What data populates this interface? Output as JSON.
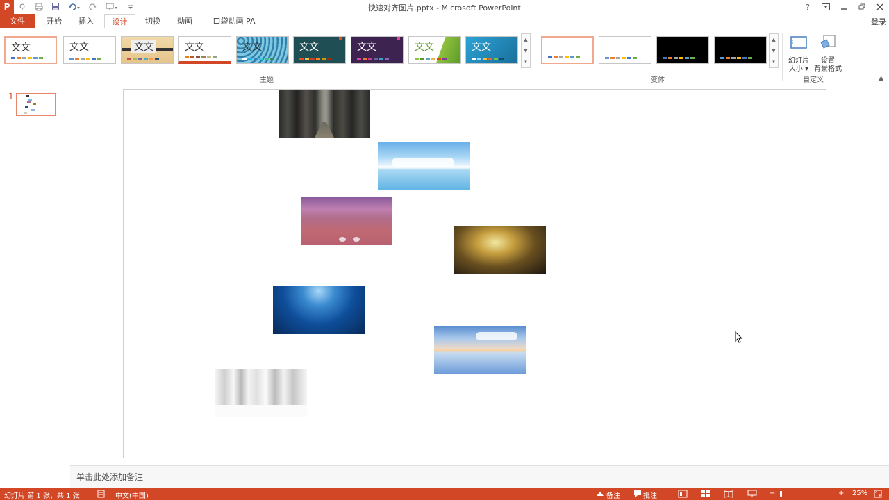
{
  "window": {
    "title": "快速对齐图片.pptx - Microsoft PowerPoint",
    "help": "?",
    "signin": "登录"
  },
  "tabs": [
    {
      "label": "文件"
    },
    {
      "label": "开始"
    },
    {
      "label": "插入"
    },
    {
      "label": "设计"
    },
    {
      "label": "切换"
    },
    {
      "label": "动画"
    },
    {
      "label": "口袋动画 PA"
    }
  ],
  "ribbon": {
    "themes_group": "主题",
    "variants_group": "变体",
    "custom_group": "自定义",
    "theme_glyph": "文文",
    "theme_glyph_alt": "文文",
    "slide_size": {
      "line1": "幻灯片",
      "line2": "大小 ▾"
    },
    "bg_format": {
      "line1": "设置",
      "line2": "背景格式"
    }
  },
  "left_pane": {
    "slide_number": "1"
  },
  "notes": {
    "placeholder": "单击此处添加备注"
  },
  "status": {
    "slide_info": "幻灯片 第 1 张，共 1 张",
    "language": "中文(中国)",
    "notes_btn": "备注",
    "comments_btn": "批注",
    "zoom": "25%",
    "minus": "−",
    "plus": "+"
  },
  "pictures": [
    {
      "name": "forest-path-picture",
      "theme": "forest"
    },
    {
      "name": "sky-sea-picture",
      "theme": "sky"
    },
    {
      "name": "pink-beach-picture",
      "theme": "beach"
    },
    {
      "name": "golden-cliff-picture",
      "theme": "cliff"
    },
    {
      "name": "underwater-picture",
      "theme": "underwater"
    },
    {
      "name": "sunset-reflection-picture",
      "theme": "sunset"
    },
    {
      "name": "snow-trees-picture",
      "theme": "snow"
    }
  ],
  "colors": {
    "accent": "#d24726",
    "status_bar": "#d24726"
  }
}
